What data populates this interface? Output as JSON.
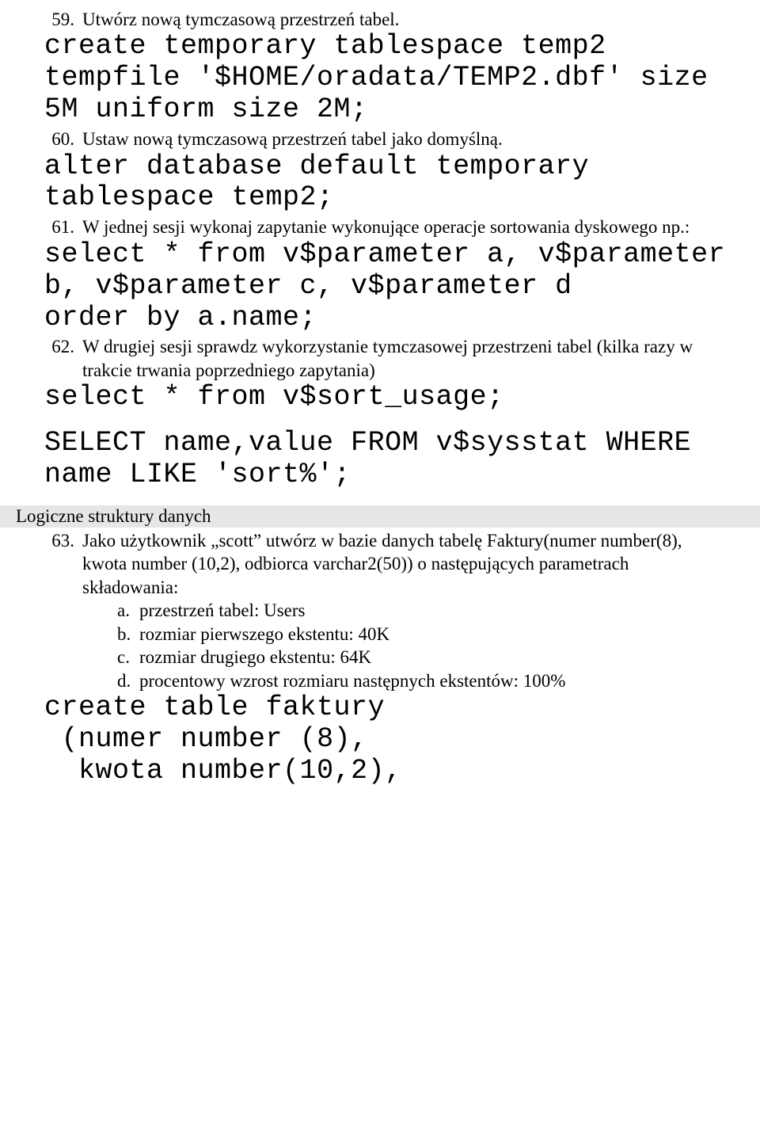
{
  "items": {
    "i59": {
      "num": "59.",
      "text": "Utwórz nową tymczasową przestrzeń tabel."
    },
    "i60": {
      "num": "60.",
      "text": "Ustaw nową tymczasową przestrzeń tabel jako domyślną."
    },
    "i61": {
      "num": "61.",
      "text": "W jednej sesji wykonaj zapytanie wykonujące operacje sortowania dyskowego np.:"
    },
    "i62": {
      "num": "62.",
      "text": "W drugiej sesji sprawdz wykorzystanie tymczasowej przestrzeni tabel (kilka razy w trakcie trwania poprzedniego zapytania)"
    },
    "i63": {
      "num": "63.",
      "text": "Jako użytkownik „scott” utwórz w bazie danych tabelę Faktury(numer number(8), kwota number (10,2), odbiorca varchar2(50)) o następujących parametrach składowania:"
    }
  },
  "code": {
    "c1": "create temporary tablespace temp2 tempfile '$HOME/oradata/TEMP2.dbf' size 5M uniform size 2M;",
    "c2": "alter database default temporary tablespace temp2;",
    "c3": "select * from v$parameter a, v$parameter b, v$parameter c, v$parameter d",
    "c3b": "order by a.name;",
    "c4": "select * from v$sort_usage;",
    "c5": "SELECT name,value FROM v$sysstat WHERE name LIKE 'sort%';",
    "c6a": "create table faktury",
    "c6b": " (numer number (8),",
    "c6c": "  kwota number(10,2),"
  },
  "section": {
    "title": "Logiczne struktury danych"
  },
  "sublist": {
    "a": {
      "mark": "a.",
      "text": "przestrzeń tabel: Users"
    },
    "b": {
      "mark": "b.",
      "text": "rozmiar pierwszego ekstentu: 40K"
    },
    "c": {
      "mark": "c.",
      "text": "rozmiar drugiego ekstentu: 64K"
    },
    "d": {
      "mark": "d.",
      "text": "procentowy wzrost rozmiaru następnych ekstentów: 100%"
    }
  }
}
